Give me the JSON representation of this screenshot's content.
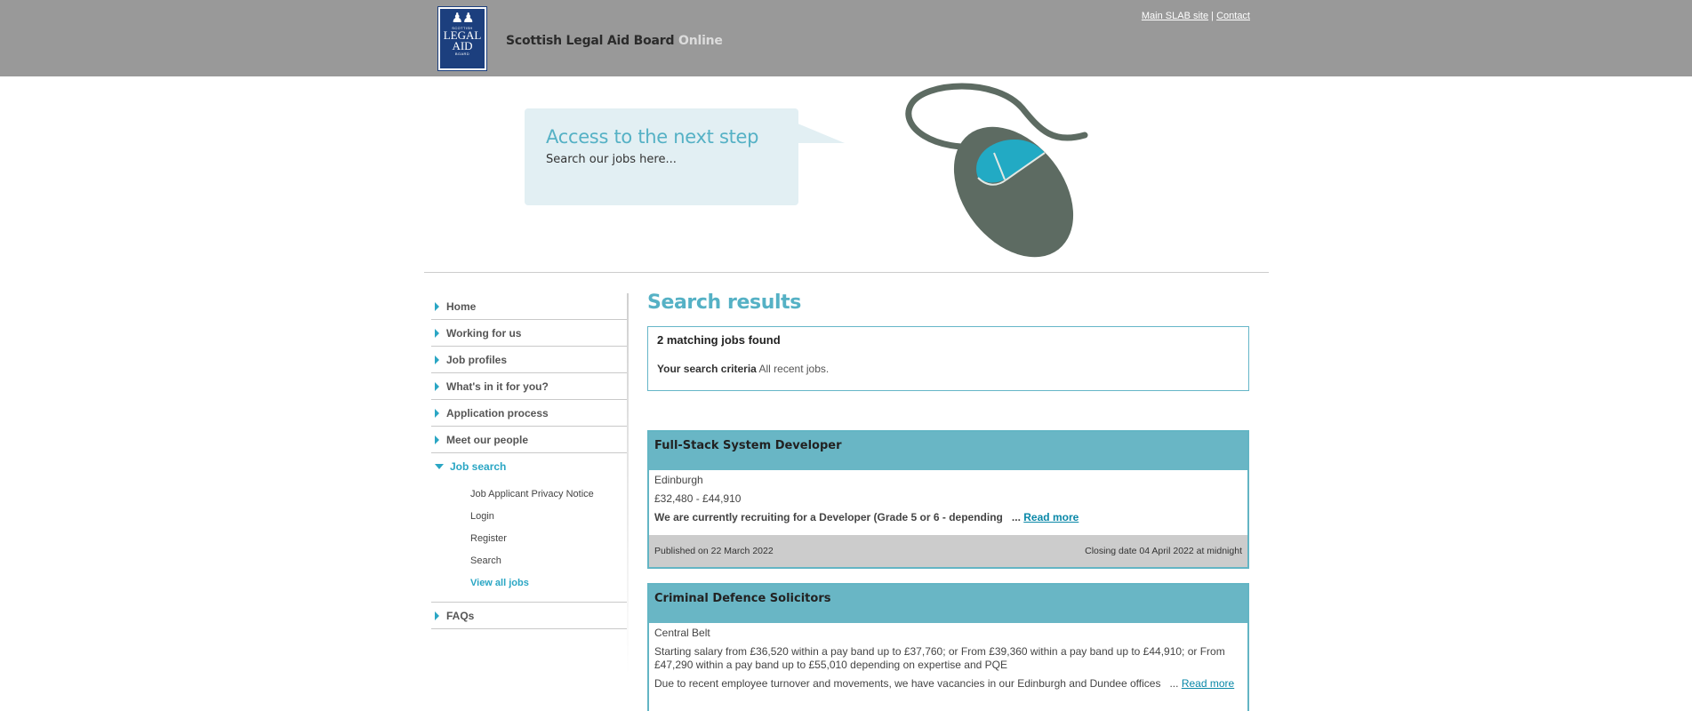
{
  "header": {
    "logo_small_top": "SCOTTISH",
    "logo_line1": "LEGAL",
    "logo_line2": "AID",
    "logo_small_bottom": "BOARD",
    "brand_name": "Scottish Legal Aid Board",
    "brand_suffix": "Online",
    "links": {
      "main_site": "Main SLAB site",
      "separator": "|",
      "contact": "Contact"
    }
  },
  "banner": {
    "title": "Access to the next step",
    "subtitle": "Search our jobs here...",
    "art_icon": "computer-mouse-icon",
    "colors": {
      "mouse_body": "#5d6b62",
      "mouse_accent": "#22aac4",
      "bubble": "#e2eff3"
    }
  },
  "sidebar": {
    "items": [
      {
        "label": "Home"
      },
      {
        "label": "Working for us"
      },
      {
        "label": "Job profiles"
      },
      {
        "label": "What's in it for you?"
      },
      {
        "label": "Application process"
      },
      {
        "label": "Meet our people"
      },
      {
        "label": "Job search"
      },
      {
        "label": "FAQs"
      }
    ],
    "subitems": [
      {
        "label": "Job Applicant Privacy Notice"
      },
      {
        "label": "Login"
      },
      {
        "label": "Register"
      },
      {
        "label": "Search"
      },
      {
        "label": "View all jobs"
      }
    ]
  },
  "main": {
    "title": "Search results",
    "summary": {
      "count_text": "2 matching jobs found",
      "criteria_label": "Your search criteria",
      "criteria_value": "All recent jobs."
    },
    "jobs": [
      {
        "title": "Full-Stack System Developer",
        "location": "Edinburgh",
        "salary": "£32,480 - £44,910",
        "description": "We are currently recruiting for a Developer (Grade 5 or 6 - depending",
        "ellipsis": "...",
        "read_more": "Read more",
        "published": "Published on 22 March 2022",
        "closing": "Closing date 04 April 2022 at midnight"
      },
      {
        "title": "Criminal Defence Solicitors",
        "location": "Central Belt",
        "salary": "Starting salary from £36,520 within a pay band up to £37,760; or From £39,360 within a pay band up to £44,910; or From £47,290 within a pay band up to £55,010 depending on expertise and PQE",
        "description": "Due to recent employee turnover and movements, we have vacancies in our Edinburgh and Dundee offices",
        "ellipsis": "...",
        "read_more": "Read more"
      }
    ]
  },
  "colors": {
    "accent": "#55b1c5",
    "header_bg": "#999999",
    "job_header": "#69b6c5"
  }
}
